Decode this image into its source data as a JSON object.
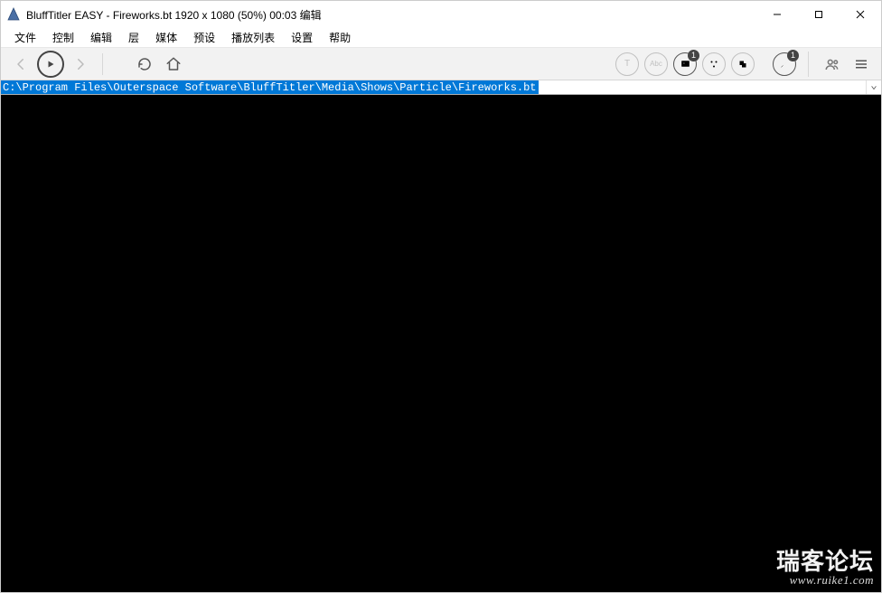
{
  "title": "BluffTitler EASY  - Fireworks.bt 1920 x 1080 (50%) 00:03 编辑",
  "menu": [
    "文件",
    "控制",
    "编辑",
    "层",
    "媒体",
    "预设",
    "播放列表",
    "设置",
    "帮助"
  ],
  "path": "C:\\Program Files\\Outerspace Software\\BluffTitler\\Media\\Shows\\Particle\\Fireworks.bt",
  "right_tools": {
    "text_label": "T",
    "abc_label": "Abc",
    "image_badge": "1",
    "brush_badge": "1"
  },
  "watermark": {
    "line1": "瑞客论坛",
    "line2": "www.ruike1.com"
  }
}
